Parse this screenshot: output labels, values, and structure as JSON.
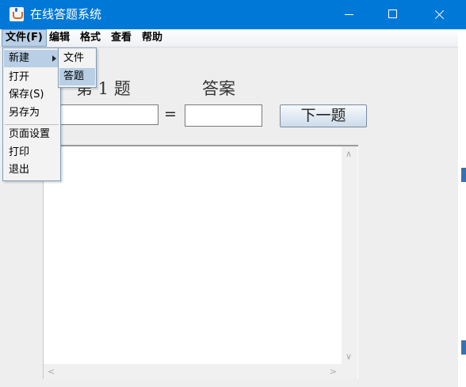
{
  "window": {
    "title": "在线答题系统",
    "accent_color": "#0078d7"
  },
  "menubar": {
    "items": [
      "文件(F)",
      "编辑",
      "格式",
      "查看",
      "帮助"
    ]
  },
  "file_menu": {
    "items": [
      "新建",
      "打开",
      "保存(S)",
      "另存为",
      "页面设置",
      "打印",
      "退出"
    ],
    "highlighted": "新建"
  },
  "new_submenu": {
    "items": [
      "文件",
      "答题"
    ],
    "highlighted": "答题"
  },
  "quiz": {
    "question_label": "第 1 题",
    "answer_label": "答案",
    "equals": "=",
    "question_value": "",
    "answer_value": "",
    "next_button": "下一题"
  },
  "text_area": {
    "content": ""
  },
  "icons": {
    "app": "java-cup-icon",
    "minimize": "minimize-icon",
    "maximize": "maximize-icon",
    "close": "close-icon"
  }
}
